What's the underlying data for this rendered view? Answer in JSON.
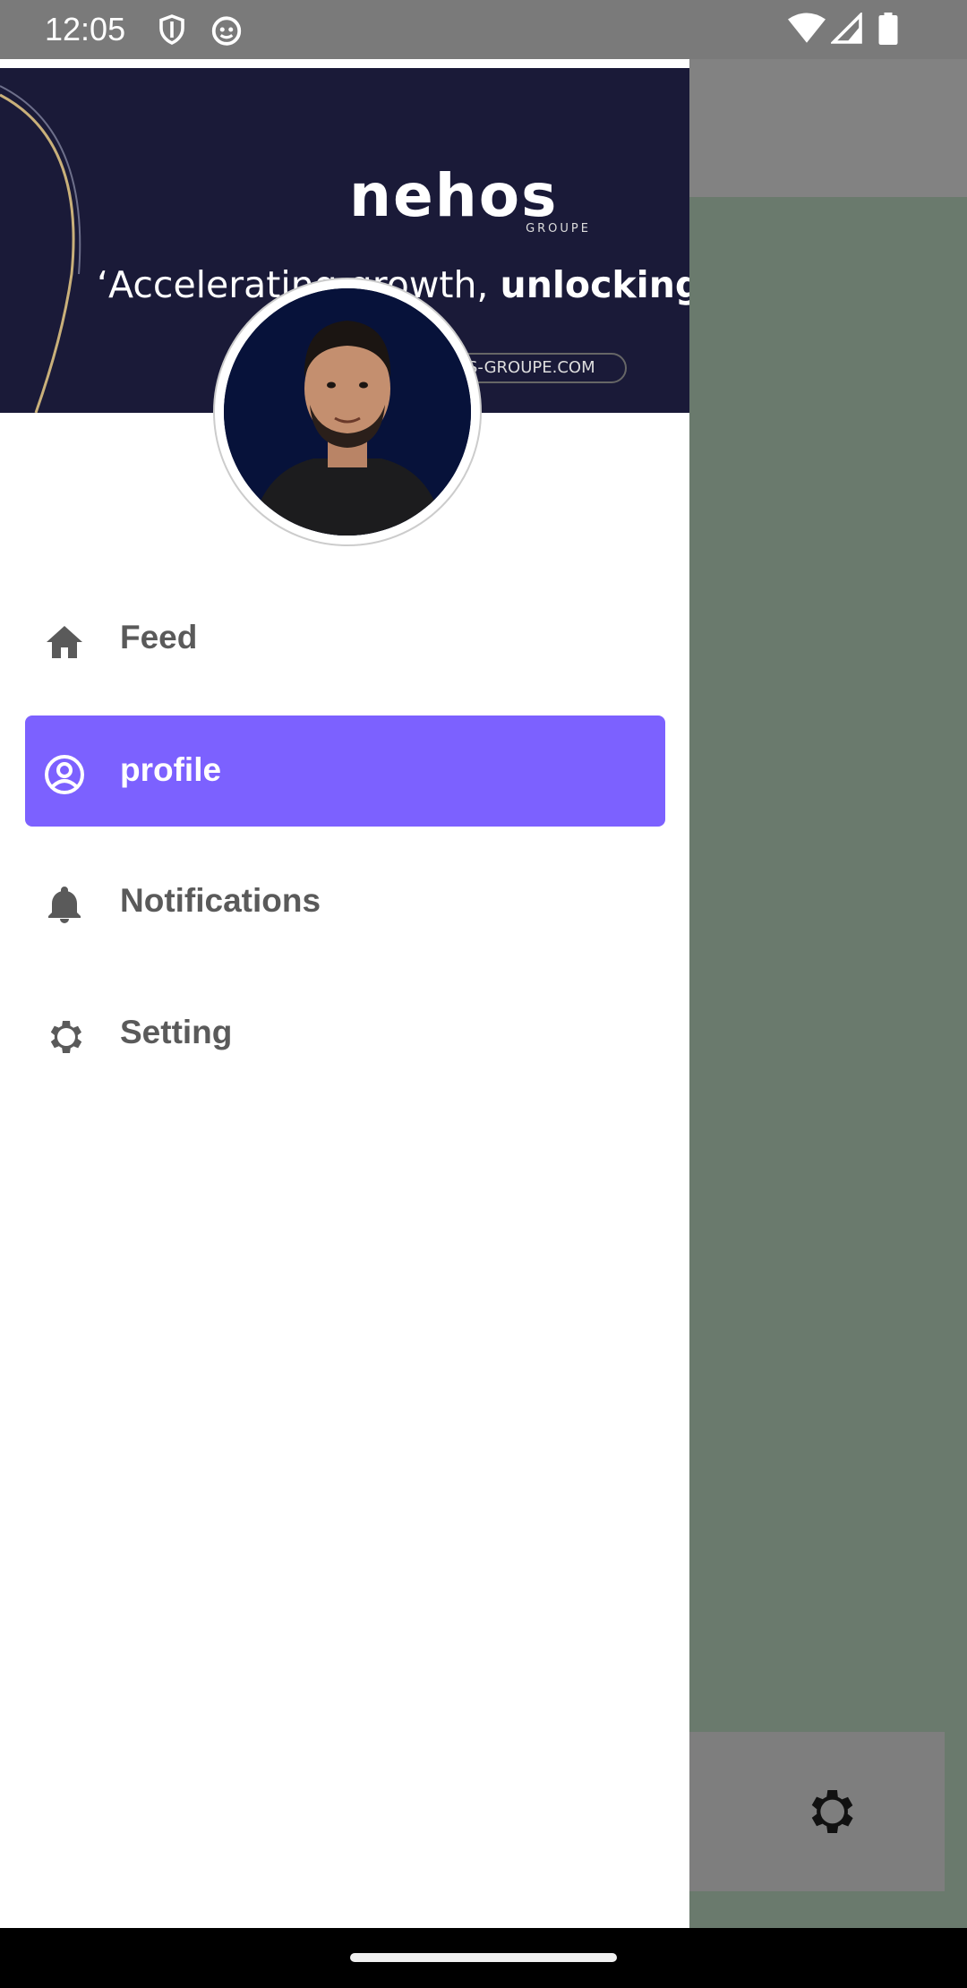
{
  "status_bar": {
    "time": "12:05",
    "icons": [
      "shield-icon",
      "cat-icon",
      "wifi-icon",
      "signal-icon",
      "battery-icon"
    ]
  },
  "banner": {
    "brand": "nehos",
    "brand_sub": "GROUPE",
    "tagline_regular": "‘Accelerating growth, ",
    "tagline_bold": "unlocking p",
    "url": "S-GROUPE.COM"
  },
  "menu": {
    "items": [
      {
        "label": "Feed",
        "icon": "home-icon",
        "active": false
      },
      {
        "label": "profile",
        "icon": "account-circle-icon",
        "active": true
      },
      {
        "label": "Notifications",
        "icon": "bell-icon",
        "active": false
      },
      {
        "label": "Setting",
        "icon": "gear-icon",
        "active": false
      }
    ]
  },
  "colors": {
    "accent": "#7c61ff",
    "banner": "#1a1a38",
    "scrim": "#6a7a6d"
  }
}
